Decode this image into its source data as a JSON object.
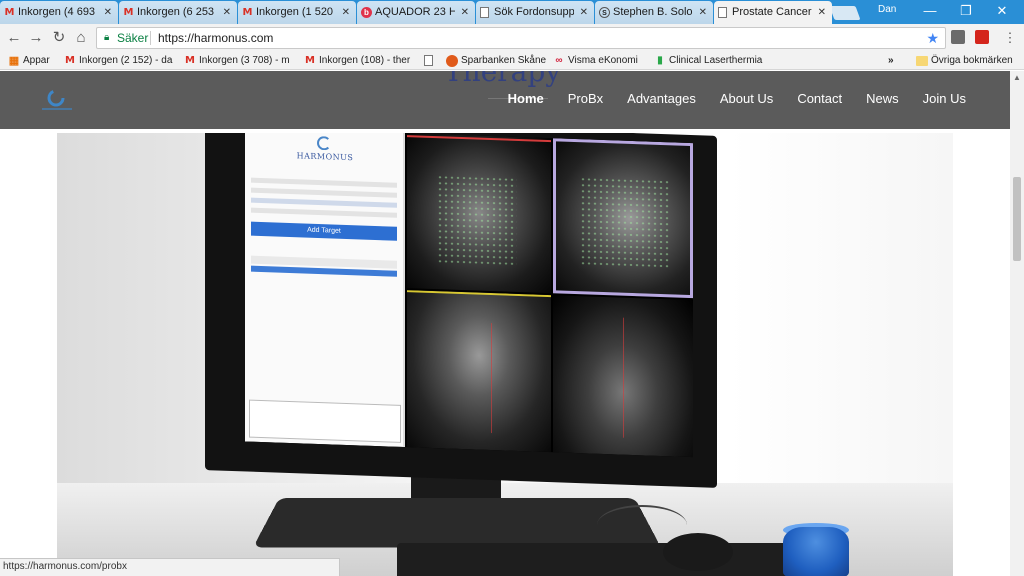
{
  "browser": {
    "tabs": [
      {
        "label": "Inkorgen (4 693",
        "icon": "gmail-icon"
      },
      {
        "label": "Inkorgen (6 253",
        "icon": "gmail-icon"
      },
      {
        "label": "Inkorgen (1 520",
        "icon": "gmail-icon"
      },
      {
        "label": "AQUADOR 23 H",
        "icon": "b-icon"
      },
      {
        "label": "Sök Fordonsupp",
        "icon": "document-icon"
      },
      {
        "label": "Stephen B. Solo",
        "icon": "circle-s-icon"
      },
      {
        "label": "Prostate Cancer",
        "icon": "document-icon",
        "active": true
      }
    ],
    "user": "Dan",
    "address": {
      "secure_label": "Säker",
      "url": "https://harmonus.com"
    },
    "bookmarks": [
      {
        "label": "Appar",
        "icon": "apps-grid-icon"
      },
      {
        "label": "Inkorgen (2 152) - da",
        "icon": "gmail-icon"
      },
      {
        "label": "Inkorgen (3 708) - m",
        "icon": "gmail-icon"
      },
      {
        "label": "Inkorgen (108) - ther",
        "icon": "gmail-icon"
      },
      {
        "label": "",
        "icon": "document-icon"
      },
      {
        "label": "Sparbanken Skåne",
        "icon": "sparbanken-icon"
      },
      {
        "label": "Visma eKonomi",
        "icon": "visma-icon"
      },
      {
        "label": "Clinical Laserthermia",
        "icon": "bar-chart-icon"
      }
    ],
    "bookmarks_overflow": "»",
    "other_bookmarks": "Övriga bokmärken",
    "status_url": "https://harmonus.com/probx"
  },
  "site": {
    "ghost_heading": "Therapy",
    "nav": [
      {
        "label": "Home",
        "current": true
      },
      {
        "label": "ProBx"
      },
      {
        "label": "Advantages"
      },
      {
        "label": "About Us"
      },
      {
        "label": "Contact"
      },
      {
        "label": "News"
      },
      {
        "label": "Join Us"
      }
    ],
    "hero_app": {
      "brand": "HARMONUS",
      "add_button": "Add Target"
    }
  },
  "colors": {
    "tab_strip": "#2a8fd6",
    "site_nav": "#5b5b5b",
    "secure": "#0b8043",
    "app_button": "#2d6fd2"
  }
}
